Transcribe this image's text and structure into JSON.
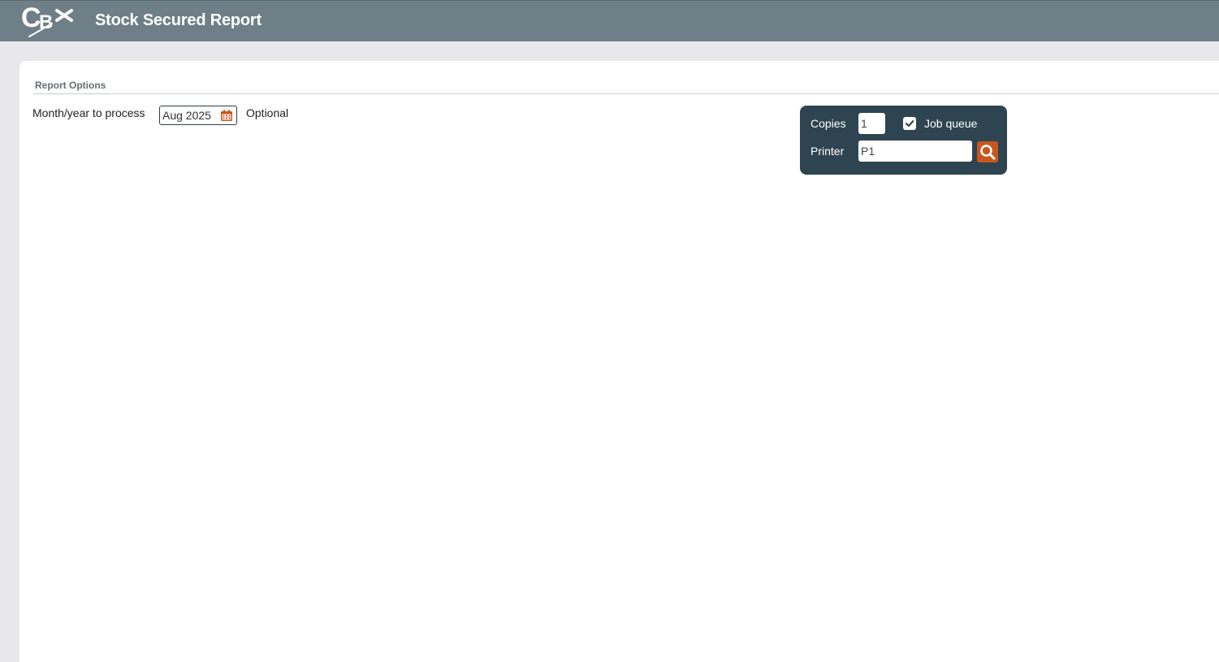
{
  "header": {
    "logo_text": "CBX",
    "title": "Stock Secured Report"
  },
  "report_options": {
    "section_title": "Report Options",
    "month_year_label": "Month/year to process",
    "month_year_value": "Aug 2025",
    "optional_text": "Optional"
  },
  "print_panel": {
    "copies_label": "Copies",
    "copies_value": "1",
    "job_queue_label": "Job queue",
    "job_queue_checked": true,
    "printer_label": "Printer",
    "printer_value": "P1"
  },
  "colors": {
    "header_bg": "#6f7f87",
    "panel_bg": "#2e4450",
    "accent": "#c9571d"
  },
  "icons": {
    "calendar": "calendar-icon",
    "search": "search-icon",
    "check": "check-icon"
  }
}
